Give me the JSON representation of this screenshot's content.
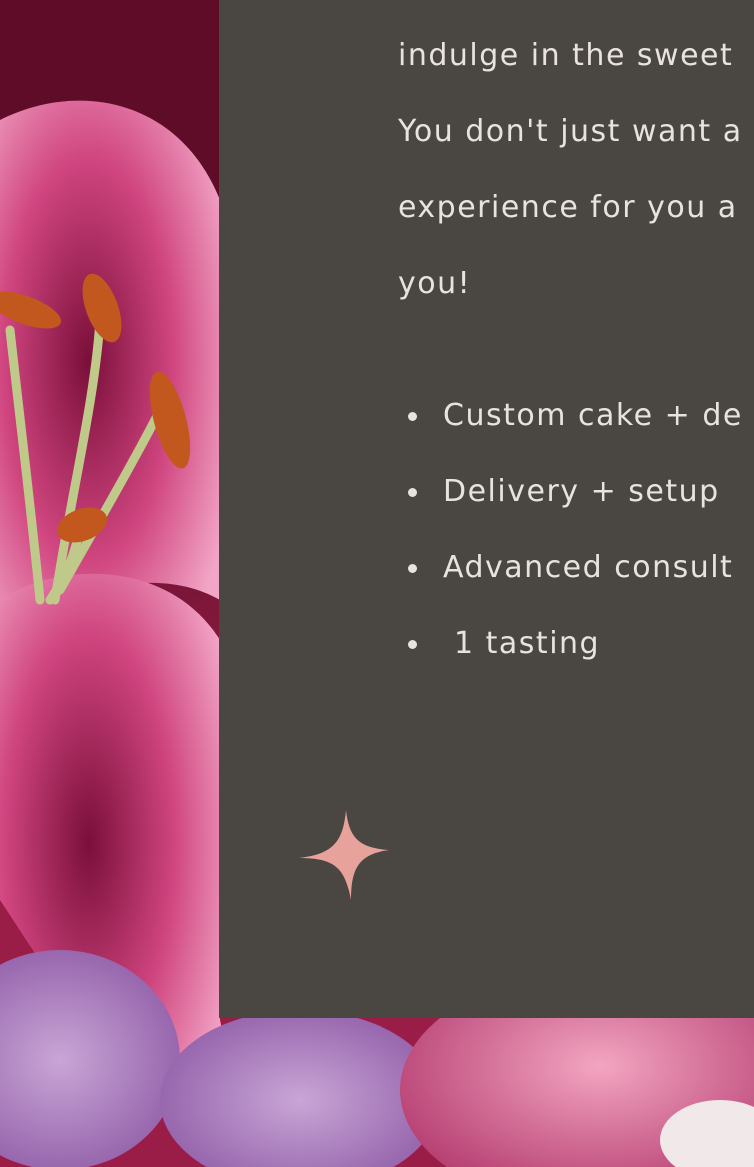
{
  "intro_lines": [
    "indulge in the sweet",
    "You don't just want a",
    "experience for you a",
    "you!"
  ],
  "features": [
    "Custom cake + de",
    "Delivery + setup",
    "Advanced consult",
    " 1 tasting"
  ],
  "colors": {
    "panel": "#4a4642",
    "text": "#e9e3df",
    "sparkle": "#e8a29c",
    "background_flower": "#c04a7f"
  },
  "icons": {
    "sparkle": "four-point-star-icon",
    "bullet": "bullet-dot"
  }
}
